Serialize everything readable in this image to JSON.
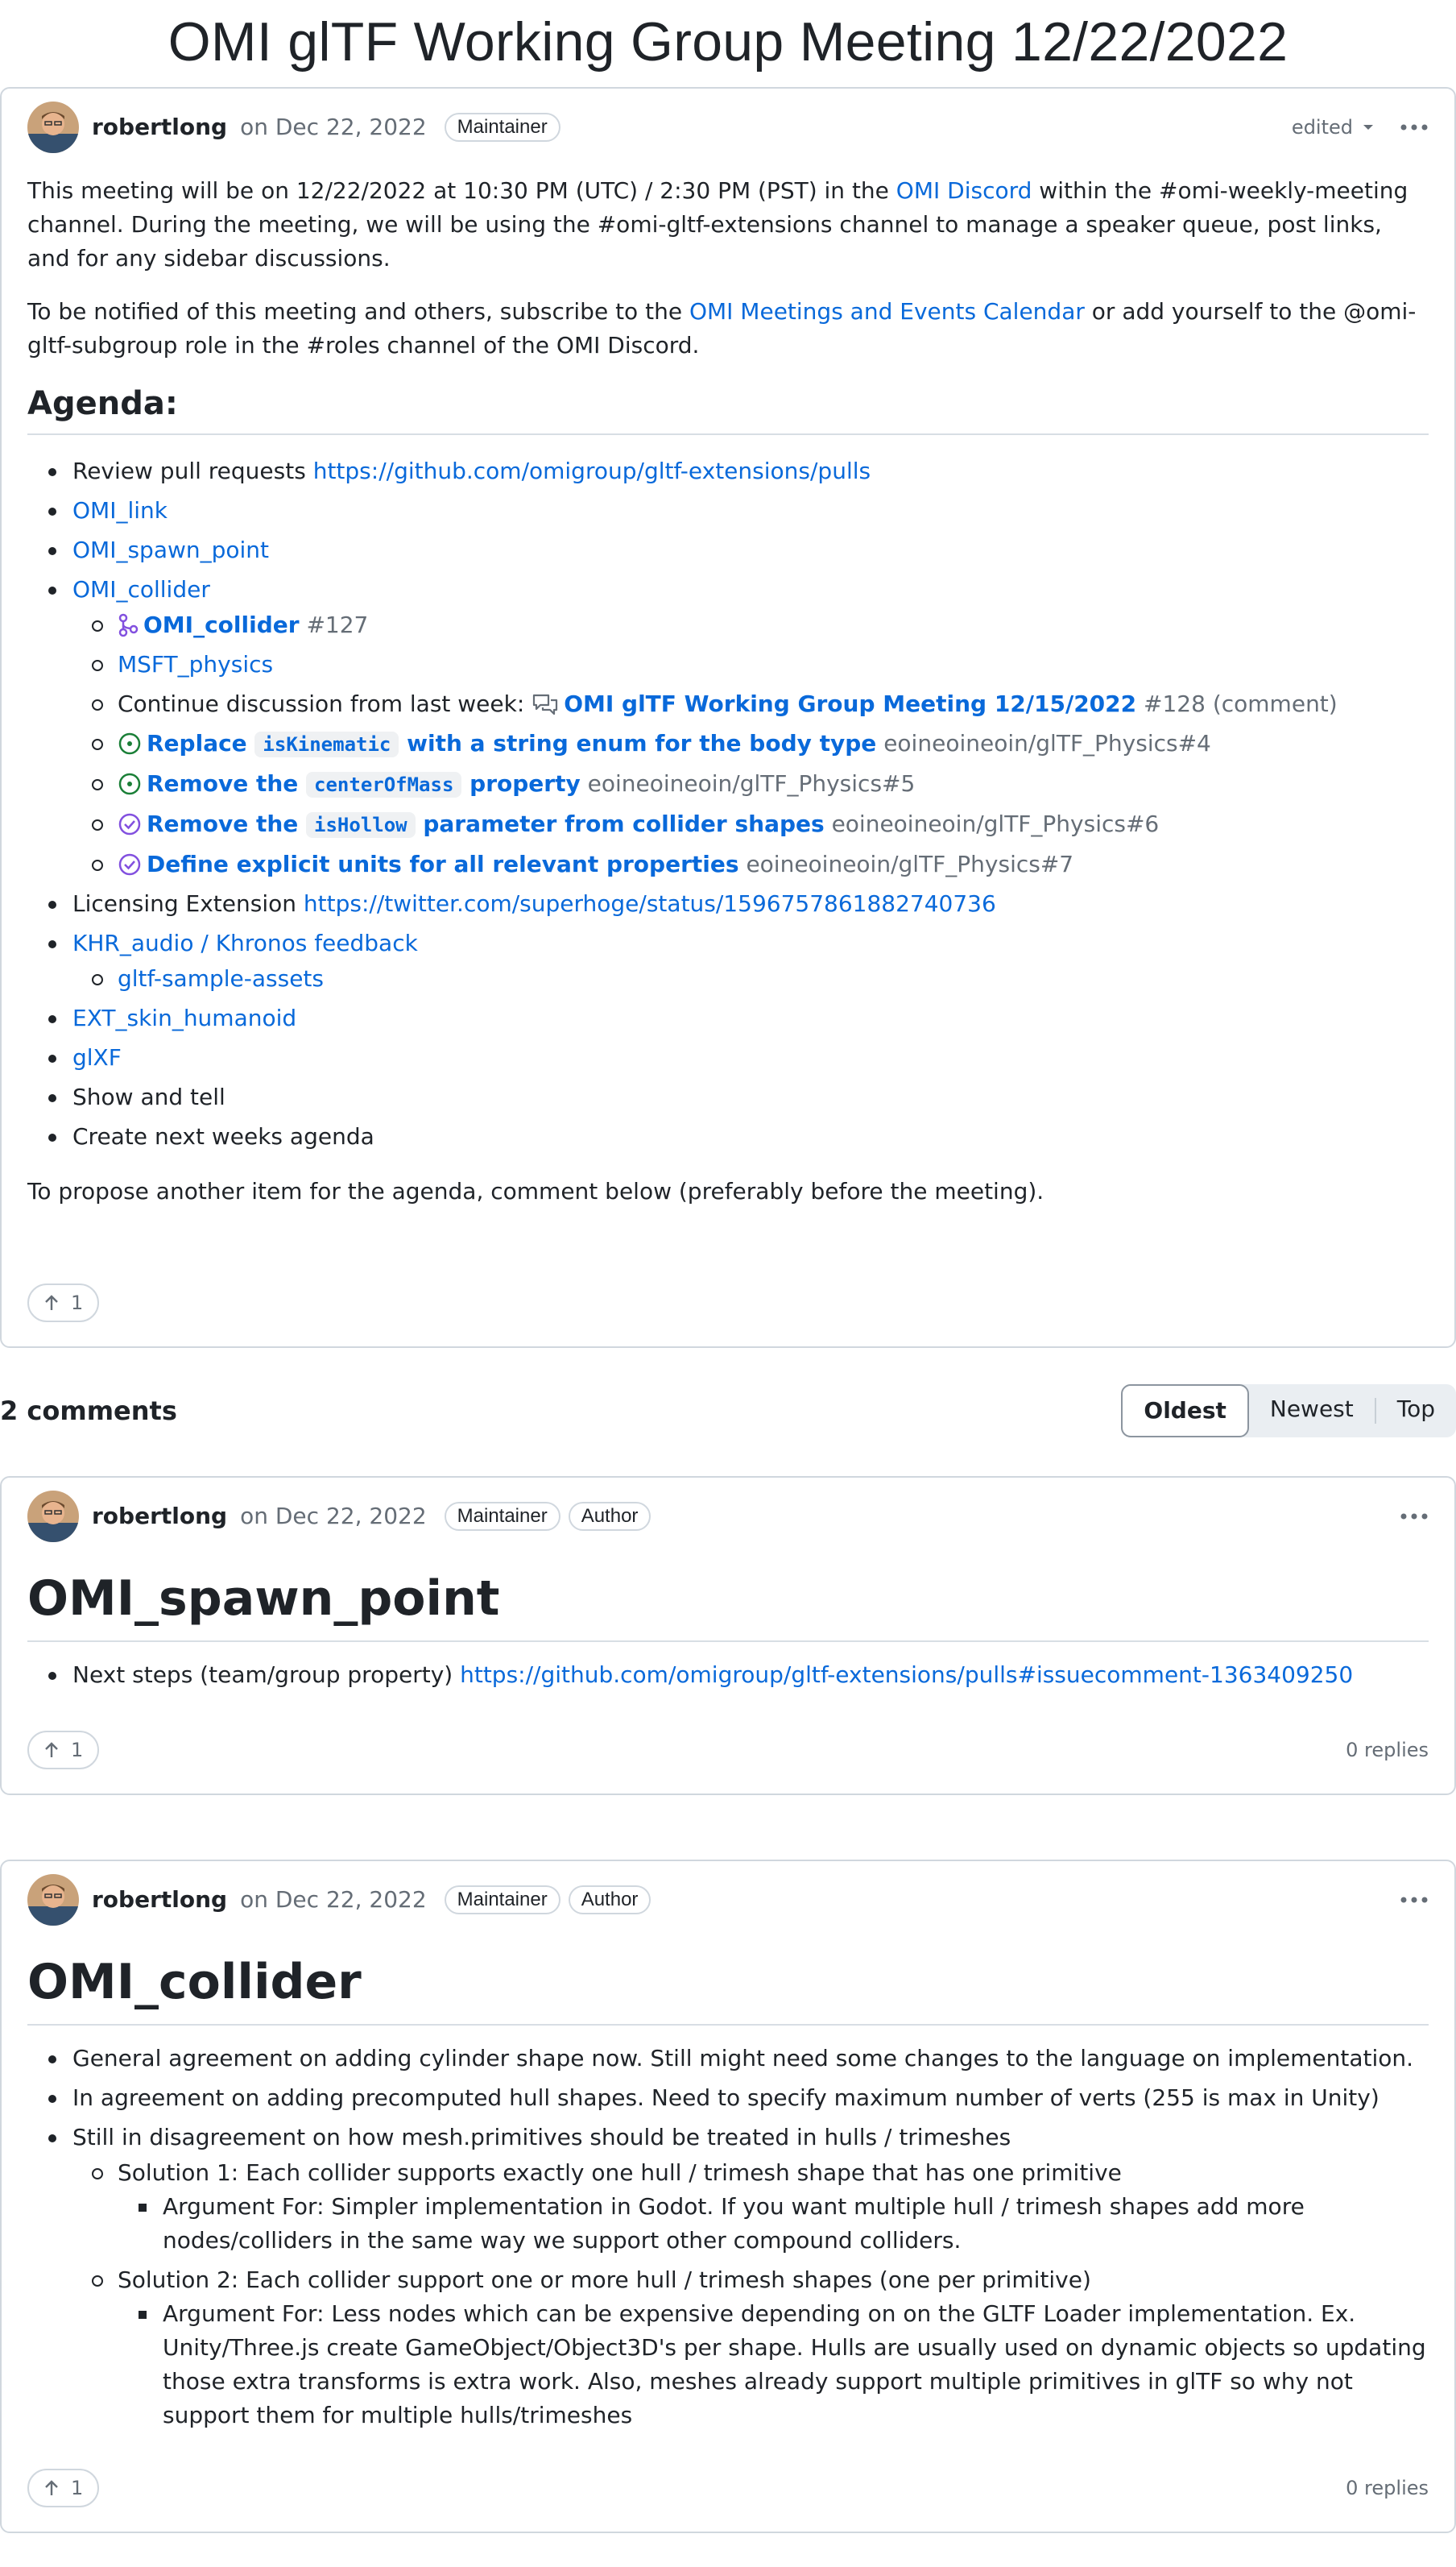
{
  "page": {
    "title": "OMI glTF Working Group Meeting 12/22/2022"
  },
  "post": {
    "author": "robertlong",
    "date": "on Dec 22, 2022",
    "label": "Maintainer",
    "edited": "edited",
    "intro": {
      "p1_a": "This meeting will be on 12/22/2022 at 10:30 PM (UTC) / 2:30 PM (PST) in the ",
      "p1_link": "OMI Discord",
      "p1_b": " within the #omi-weekly-meeting channel. During the meeting, we will be using the #omi-gltf-extensions channel to manage a speaker queue, post links, and for any sidebar discussions.",
      "p2_a": "To be notified of this meeting and others, subscribe to the ",
      "p2_link": "OMI Meetings and Events Calendar",
      "p2_b": " or add yourself to the @omi-gltf-subgroup role in the #roles channel of the OMI Discord."
    },
    "agenda_heading": "Agenda:",
    "agenda": {
      "review_text": "Review pull requests ",
      "review_link": "https://github.com/omigroup/gltf-extensions/pulls",
      "omi_link": "OMI_link",
      "omi_spawn": "OMI_spawn_point",
      "omi_collider": "OMI_collider",
      "collider_pr_title": "OMI_collider",
      "collider_pr_num": "#127",
      "msft_physics": "MSFT_physics",
      "continue_text": "Continue discussion from last week: ",
      "continue_title": "OMI glTF Working Group Meeting 12/15/2022",
      "continue_ref": "#128 (comment)",
      "issue1_a": "Replace ",
      "issue1_code": "isKinematic",
      "issue1_b": " with a string enum for the body type",
      "issue1_ref": "eoineoineoin/glTF_Physics#4",
      "issue2_a": "Remove the ",
      "issue2_code": "centerOfMass",
      "issue2_b": " property",
      "issue2_ref": "eoineoineoin/glTF_Physics#5",
      "issue3_a": "Remove the ",
      "issue3_code": "isHollow",
      "issue3_b": " parameter from collider shapes",
      "issue3_ref": "eoineoineoin/glTF_Physics#6",
      "issue4_title": "Define explicit units for all relevant properties",
      "issue4_ref": "eoineoineoin/glTF_Physics#7",
      "licensing_text": "Licensing Extension ",
      "licensing_link": "https://twitter.com/superhoge/status/1596757861882740736",
      "khr_audio": "KHR_audio / Khronos feedback",
      "gltf_sample": "gltf-sample-assets",
      "ext_skin": "EXT_skin_humanoid",
      "glxf": "glXF",
      "show_tell": "Show and tell",
      "next_agenda": "Create next weeks agenda"
    },
    "outro": "To propose another item for the agenda, comment below (preferably before the meeting).",
    "votes": "1"
  },
  "comments_header": {
    "count": "2 comments",
    "sort_options": [
      "Oldest",
      "Newest",
      "Top"
    ],
    "sort_selected": "Oldest"
  },
  "comment1": {
    "author": "robertlong",
    "date": "on Dec 22, 2022",
    "label1": "Maintainer",
    "label2": "Author",
    "title": "OMI_spawn_point",
    "item_text": "Next steps (team/group property) ",
    "item_link": "https://github.com/omigroup/gltf-extensions/pulls#issuecomment-1363409250",
    "votes": "1",
    "replies": "0 replies"
  },
  "comment2": {
    "author": "robertlong",
    "date": "on Dec 22, 2022",
    "label1": "Maintainer",
    "label2": "Author",
    "title": "OMI_collider",
    "b1": "General agreement on adding cylinder shape now. Still might need some changes to the language on implementation.",
    "b2": "In agreement on adding precomputed hull shapes. Need to specify maximum number of verts (255 is max in Unity)",
    "b3": "Still in disagreement on how mesh.primitives should be treated in hulls / trimeshes",
    "s1": "Solution 1: Each collider supports exactly one hull / trimesh shape that has one primitive",
    "s1_arg": "Argument For: Simpler implementation in Godot. If you want multiple hull / trimesh shapes add more nodes/colliders in the same way we support other compound colliders.",
    "s2": "Solution 2: Each collider support one or more hull / trimesh shapes (one per primitive)",
    "s2_arg": "Argument For: Less nodes which can be expensive depending on on the GLTF Loader implementation. Ex. Unity/Three.js create GameObject/Object3D's per shape. Hulls are usually used on dynamic objects so updating those extra transforms is extra work. Also, meshes already support multiple primitives in glTF so why not support them for multiple hulls/trimeshes",
    "votes": "1",
    "replies": "0 replies"
  },
  "colors": {
    "link": "#0969da",
    "muted": "#656d76",
    "border": "#d0d7de",
    "open_issue": "#1a7f37",
    "closed_issue": "#8250df"
  },
  "icons": [
    "avatar",
    "chevron-down-icon",
    "kebab-icon",
    "pull-request-icon",
    "discussion-icon",
    "issue-open-icon",
    "issue-closed-icon",
    "arrow-up-icon"
  ]
}
